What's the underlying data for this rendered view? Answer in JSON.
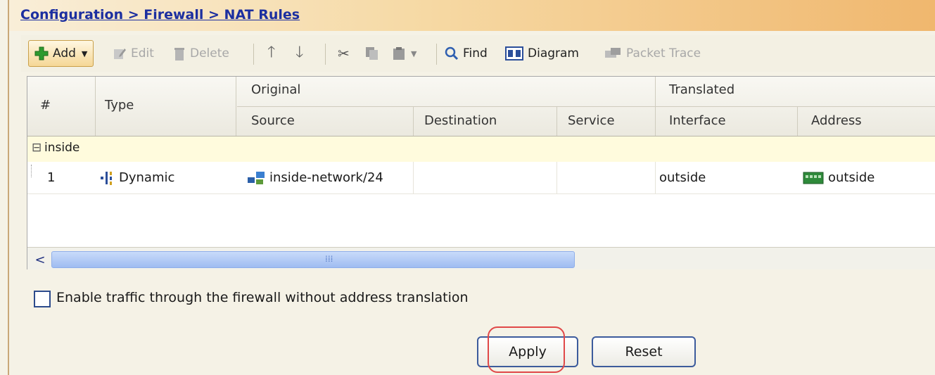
{
  "breadcrumb": "Configuration > Firewall > NAT Rules",
  "toolbar": {
    "add": "Add",
    "edit": "Edit",
    "delete": "Delete",
    "find": "Find",
    "diagram": "Diagram",
    "packet_trace": "Packet Trace"
  },
  "table": {
    "headers": {
      "num": "#",
      "type": "Type",
      "original": "Original",
      "translated": "Translated",
      "source": "Source",
      "destination": "Destination",
      "service": "Service",
      "interface": "Interface",
      "address": "Address"
    },
    "group": {
      "toggle": "⊟",
      "label": "inside"
    },
    "rows": [
      {
        "num": "1",
        "type": "Dynamic",
        "source": "inside-network/24",
        "destination": "",
        "service": "",
        "interface": "outside",
        "address": "outside"
      }
    ]
  },
  "scroll": {
    "left_arrow": "<",
    "grip": "⁞⁞⁞"
  },
  "options": {
    "bypass_label": "Enable traffic through the firewall without address translation",
    "bypass_checked": false
  },
  "buttons": {
    "apply": "Apply",
    "reset": "Reset"
  },
  "icons": {
    "add": "plus-icon",
    "edit": "edit-icon",
    "delete": "trash-icon",
    "up": "arrow-up-icon",
    "down": "arrow-down-icon",
    "cut": "scissors-icon",
    "copy": "copy-icon",
    "paste": "paste-icon",
    "find": "magnifier-icon",
    "diagram": "diagram-icon",
    "packet_trace": "packet-trace-icon",
    "dynamic": "dynamic-nat-icon",
    "network": "network-object-icon",
    "interface": "interface-icon"
  },
  "colors": {
    "breadcrumb": "#1c2fa0",
    "add_green": "#2e9a2e",
    "highlight": "#e04848",
    "group_row": "#fffbdd"
  }
}
